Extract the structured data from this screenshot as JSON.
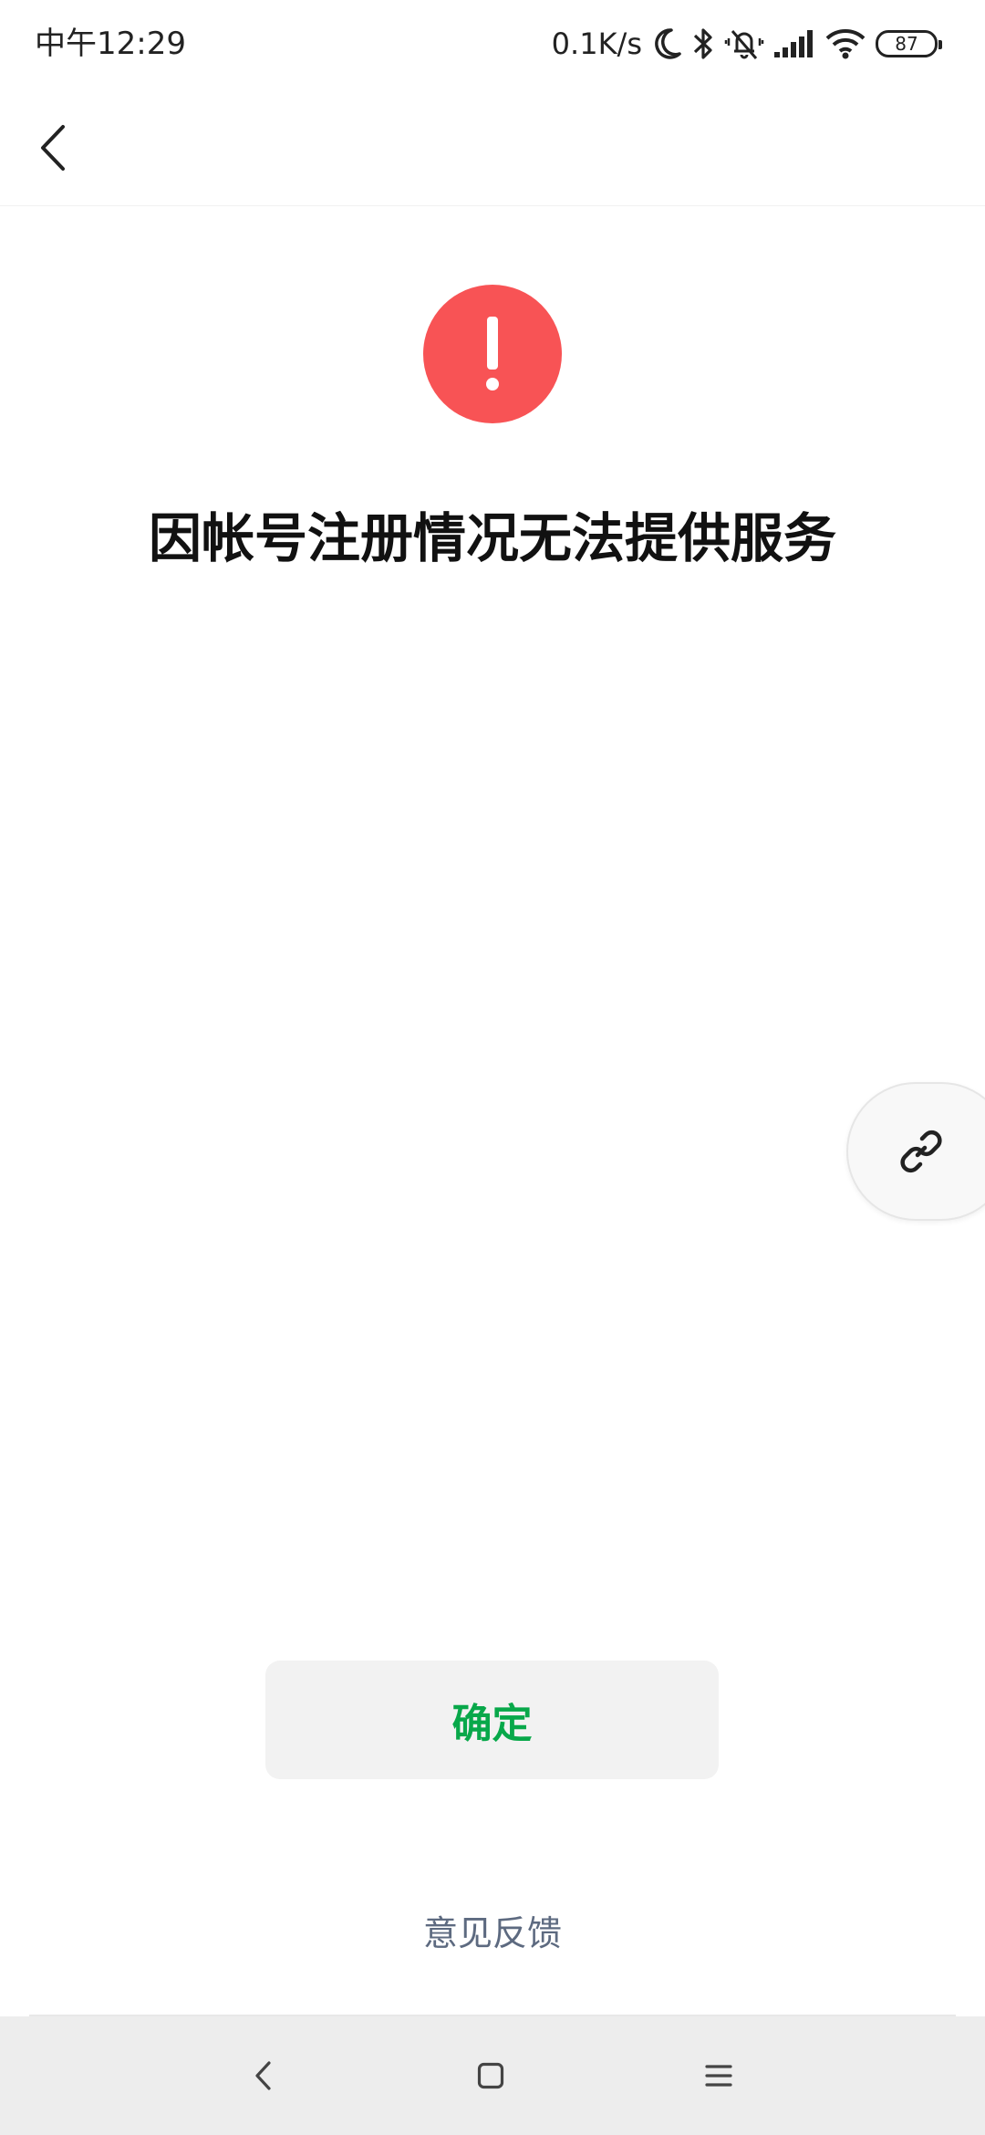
{
  "status_bar": {
    "time": "中午12:29",
    "net_speed": "0.1K/s",
    "battery_level": "87",
    "icons": [
      "moon-icon",
      "bluetooth-icon",
      "mute-bell-icon",
      "signal-icon",
      "wifi-icon",
      "battery-icon"
    ]
  },
  "header": {
    "back_icon": "chevron-left-icon"
  },
  "content": {
    "alert_icon": "exclamation-icon",
    "alert_color": "#f85355",
    "title": "因帐号注册情况无法提供服务"
  },
  "floating_button": {
    "icon": "link-icon"
  },
  "actions": {
    "confirm_label": "确定",
    "confirm_color": "#08a84a",
    "feedback_label": "意见反馈",
    "feedback_color": "#5d6a80"
  },
  "nav_bar": {
    "buttons": [
      "nav-back-icon",
      "nav-home-icon",
      "nav-menu-icon"
    ]
  }
}
